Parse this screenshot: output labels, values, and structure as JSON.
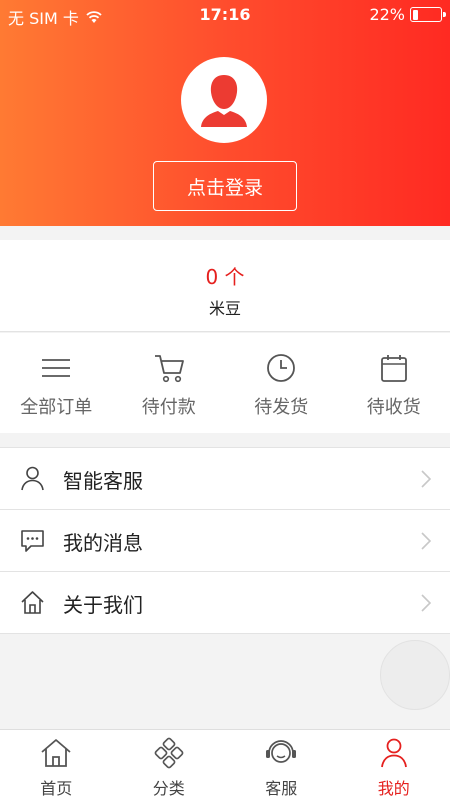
{
  "status_bar": {
    "carrier": "无 SIM 卡",
    "time": "17:16",
    "battery": "22%",
    "battery_level": 0.22
  },
  "profile": {
    "login_label": "点击登录"
  },
  "points": {
    "value": "0 个",
    "label": "米豆"
  },
  "orders": [
    {
      "label": "全部订单",
      "icon": "list-icon"
    },
    {
      "label": "待付款",
      "icon": "cart-icon"
    },
    {
      "label": "待发货",
      "icon": "clock-icon"
    },
    {
      "label": "待收货",
      "icon": "calendar-icon"
    }
  ],
  "menu": [
    {
      "label": "智能客服",
      "icon": "person-icon"
    },
    {
      "label": "我的消息",
      "icon": "message-icon"
    },
    {
      "label": "关于我们",
      "icon": "home-icon"
    }
  ],
  "tabs": [
    {
      "label": "首页",
      "icon": "home-icon",
      "active": false
    },
    {
      "label": "分类",
      "icon": "category-icon",
      "active": false
    },
    {
      "label": "客服",
      "icon": "headset-icon",
      "active": false
    },
    {
      "label": "我的",
      "icon": "user-icon",
      "active": true
    }
  ],
  "colors": {
    "accent": "#e5201e",
    "header_start": "#ff7a33",
    "header_end": "#ff2a22"
  }
}
